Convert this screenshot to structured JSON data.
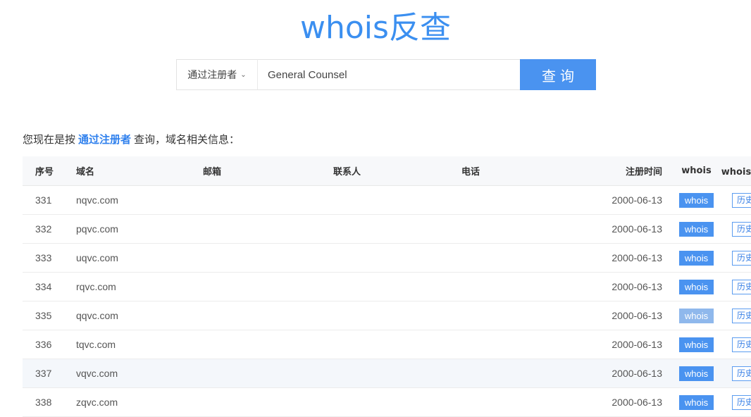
{
  "title": "whois反查",
  "search": {
    "mode": "通过注册者",
    "value": "General Counsel",
    "button": "查询"
  },
  "info": {
    "prefix": "您现在是按",
    "mode": "通过注册者",
    "suffix": "查询，域名相关信息："
  },
  "table": {
    "headers": [
      "序号",
      "域名",
      "邮箱",
      "联系人",
      "电话",
      "注册时间",
      "whois",
      "whois历史"
    ],
    "rows": [
      {
        "no": "331",
        "domain": "nqvc.com",
        "email": "",
        "contact": "",
        "phone": "",
        "date": "2000-06-13",
        "whois": "whois",
        "history": "历史"
      },
      {
        "no": "332",
        "domain": "pqvc.com",
        "email": "",
        "contact": "",
        "phone": "",
        "date": "2000-06-13",
        "whois": "whois",
        "history": "历史"
      },
      {
        "no": "333",
        "domain": "uqvc.com",
        "email": "",
        "contact": "",
        "phone": "",
        "date": "2000-06-13",
        "whois": "whois",
        "history": "历史"
      },
      {
        "no": "334",
        "domain": "rqvc.com",
        "email": "",
        "contact": "",
        "phone": "",
        "date": "2000-06-13",
        "whois": "whois",
        "history": "历史"
      },
      {
        "no": "335",
        "domain": "qqvc.com",
        "email": "",
        "contact": "",
        "phone": "",
        "date": "2000-06-13",
        "whois": "whois",
        "history": "历史"
      },
      {
        "no": "336",
        "domain": "tqvc.com",
        "email": "",
        "contact": "",
        "phone": "",
        "date": "2000-06-13",
        "whois": "whois",
        "history": "历史"
      },
      {
        "no": "337",
        "domain": "vqvc.com",
        "email": "",
        "contact": "",
        "phone": "",
        "date": "2000-06-13",
        "whois": "whois",
        "history": "历史"
      },
      {
        "no": "338",
        "domain": "zqvc.com",
        "email": "",
        "contact": "",
        "phone": "",
        "date": "2000-06-13",
        "whois": "whois",
        "history": "历史"
      }
    ]
  },
  "icons": {
    "select_chevron": "chevron-down-icon"
  },
  "colors": {
    "accent": "#4a93f0",
    "link": "#2f80ed"
  }
}
